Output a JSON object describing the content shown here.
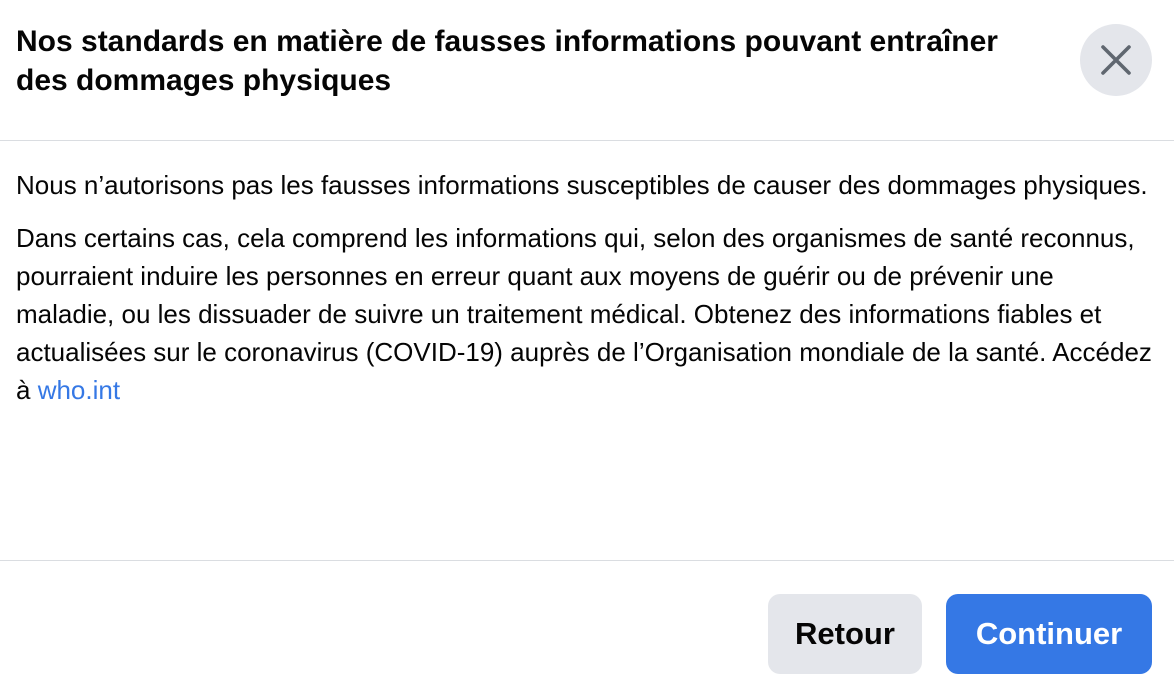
{
  "dialog": {
    "title": "Nos standards en matière de fausses informations pouvant entraîner des dommages physiques",
    "paragraph1": "Nous n’autorisons pas les fausses informations susceptibles de causer des dommages physiques.",
    "paragraph2_text": "Dans certains cas, cela comprend les informations qui, selon des organismes de santé reconnus, pourraient induire les personnes en erreur quant aux moyens de guérir ou de prévenir une maladie, ou les dissuader de suivre un traitement médical. Obtenez des informations fiables et actualisées sur le coronavirus (COVID-19) auprès de l’Organisation mondiale de la santé. Accédez à ",
    "paragraph2_link": "who.int",
    "close_icon": "close-icon"
  },
  "footer": {
    "back_label": "Retour",
    "continue_label": "Continuer"
  },
  "colors": {
    "primary": "#3578e5",
    "secondary_button": "#e4e6eb",
    "divider": "#dadde1",
    "text": "#050505"
  }
}
